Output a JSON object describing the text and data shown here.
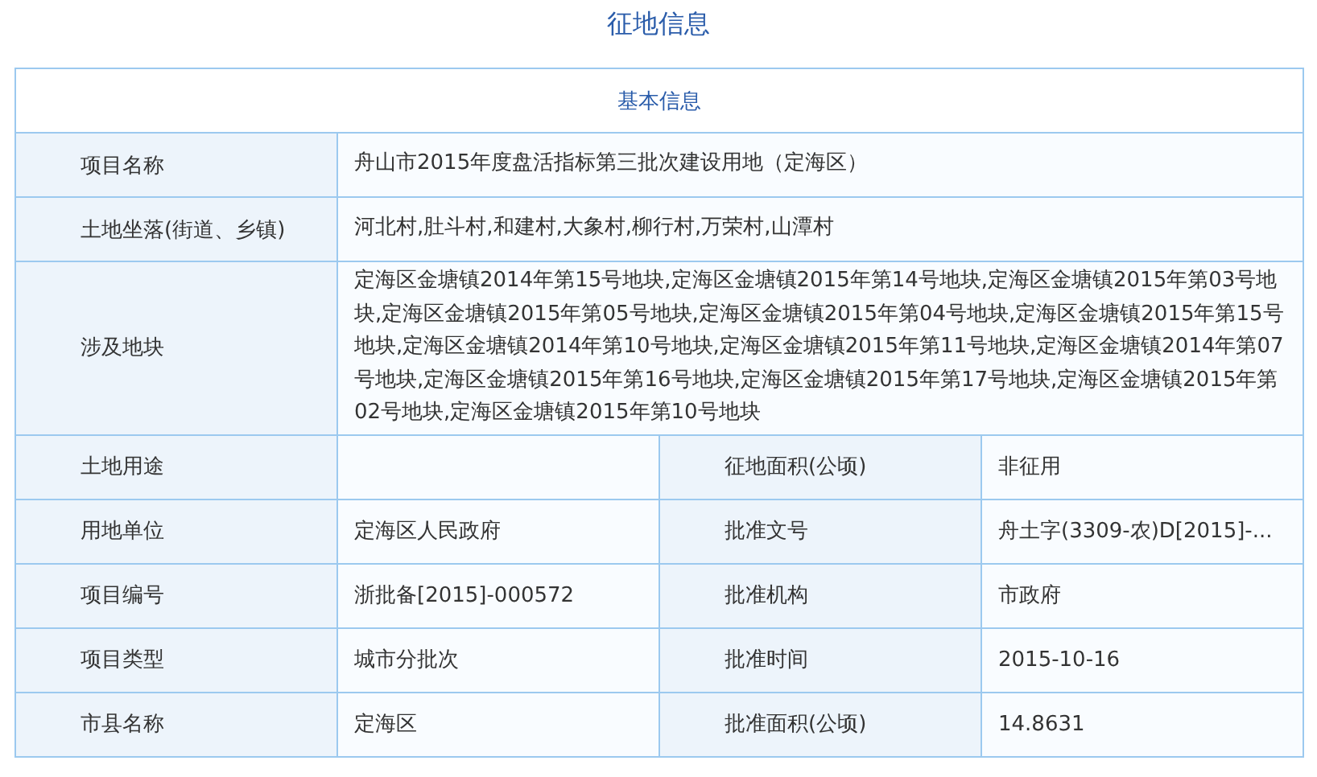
{
  "title": "征地信息",
  "section_title": "基本信息",
  "rows": [
    {
      "kind": "wide",
      "label": "项目名称",
      "value": "舟山市2015年度盘活指标第三批次建设用地（定海区）"
    },
    {
      "kind": "wide",
      "label": "土地坐落(街道、乡镇)",
      "value": "河北村,肚斗村,和建村,大象村,柳行村,万荣村,山潭村"
    },
    {
      "kind": "wide",
      "label": "涉及地块",
      "value": "定海区金塘镇2014年第15号地块,定海区金塘镇2015年第14号地块,定海区金塘镇2015年第03号地块,定海区金塘镇2015年第05号地块,定海区金塘镇2015年第04号地块,定海区金塘镇2015年第15号地块,定海区金塘镇2014年第10号地块,定海区金塘镇2015年第11号地块,定海区金塘镇2014年第07号地块,定海区金塘镇2015年第16号地块,定海区金塘镇2015年第17号地块,定海区金塘镇2015年第02号地块,定海区金塘镇2015年第10号地块"
    },
    {
      "kind": "pair",
      "label": "土地用途",
      "label_2": "征地面积(公顷)",
      "value_2": "非征用"
    },
    {
      "kind": "pair",
      "label": "用地单位",
      "value": "定海区人民政府",
      "label_2": "批准文号",
      "value_2": "舟土字(3309-农)D[2015]-..."
    },
    {
      "kind": "pair",
      "label": "项目编号",
      "value": "浙批备[2015]-000572",
      "label_2": "批准机构",
      "value_2": "市政府"
    },
    {
      "kind": "pair",
      "label": "项目类型",
      "value": "城市分批次",
      "label_2": "批准时间",
      "value_2": "2015-10-16"
    },
    {
      "kind": "pair",
      "label": "市县名称",
      "value": "定海区",
      "label_2": "批准面积(公顷)",
      "value_2": "14.8631"
    }
  ]
}
